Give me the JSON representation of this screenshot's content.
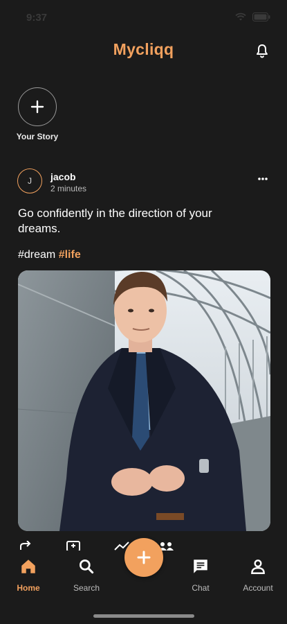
{
  "status_bar": {
    "time": "9:37"
  },
  "header": {
    "title": "Mycliqq",
    "icon": "bell-icon"
  },
  "stories": {
    "add_label": "Your Story",
    "add_icon": "plus-icon"
  },
  "post": {
    "avatar_initial": "J",
    "username": "jacob",
    "time": "2 minutes",
    "text": "Go confidently in the direction of your dreams.",
    "tags": [
      "#dream",
      "#life"
    ],
    "more_icon": "more-horizontal-icon"
  },
  "bottom_nav": {
    "items": [
      {
        "label": "Home",
        "icon": "home-icon",
        "active": true
      },
      {
        "label": "Search",
        "icon": "search-icon",
        "active": false
      },
      {
        "label": "Chat",
        "icon": "chat-icon",
        "active": false
      },
      {
        "label": "Account",
        "icon": "account-icon",
        "active": false
      }
    ],
    "fab_icon": "plus-icon"
  },
  "colors": {
    "accent": "#f2a15e",
    "background": "#1b1b1b"
  }
}
